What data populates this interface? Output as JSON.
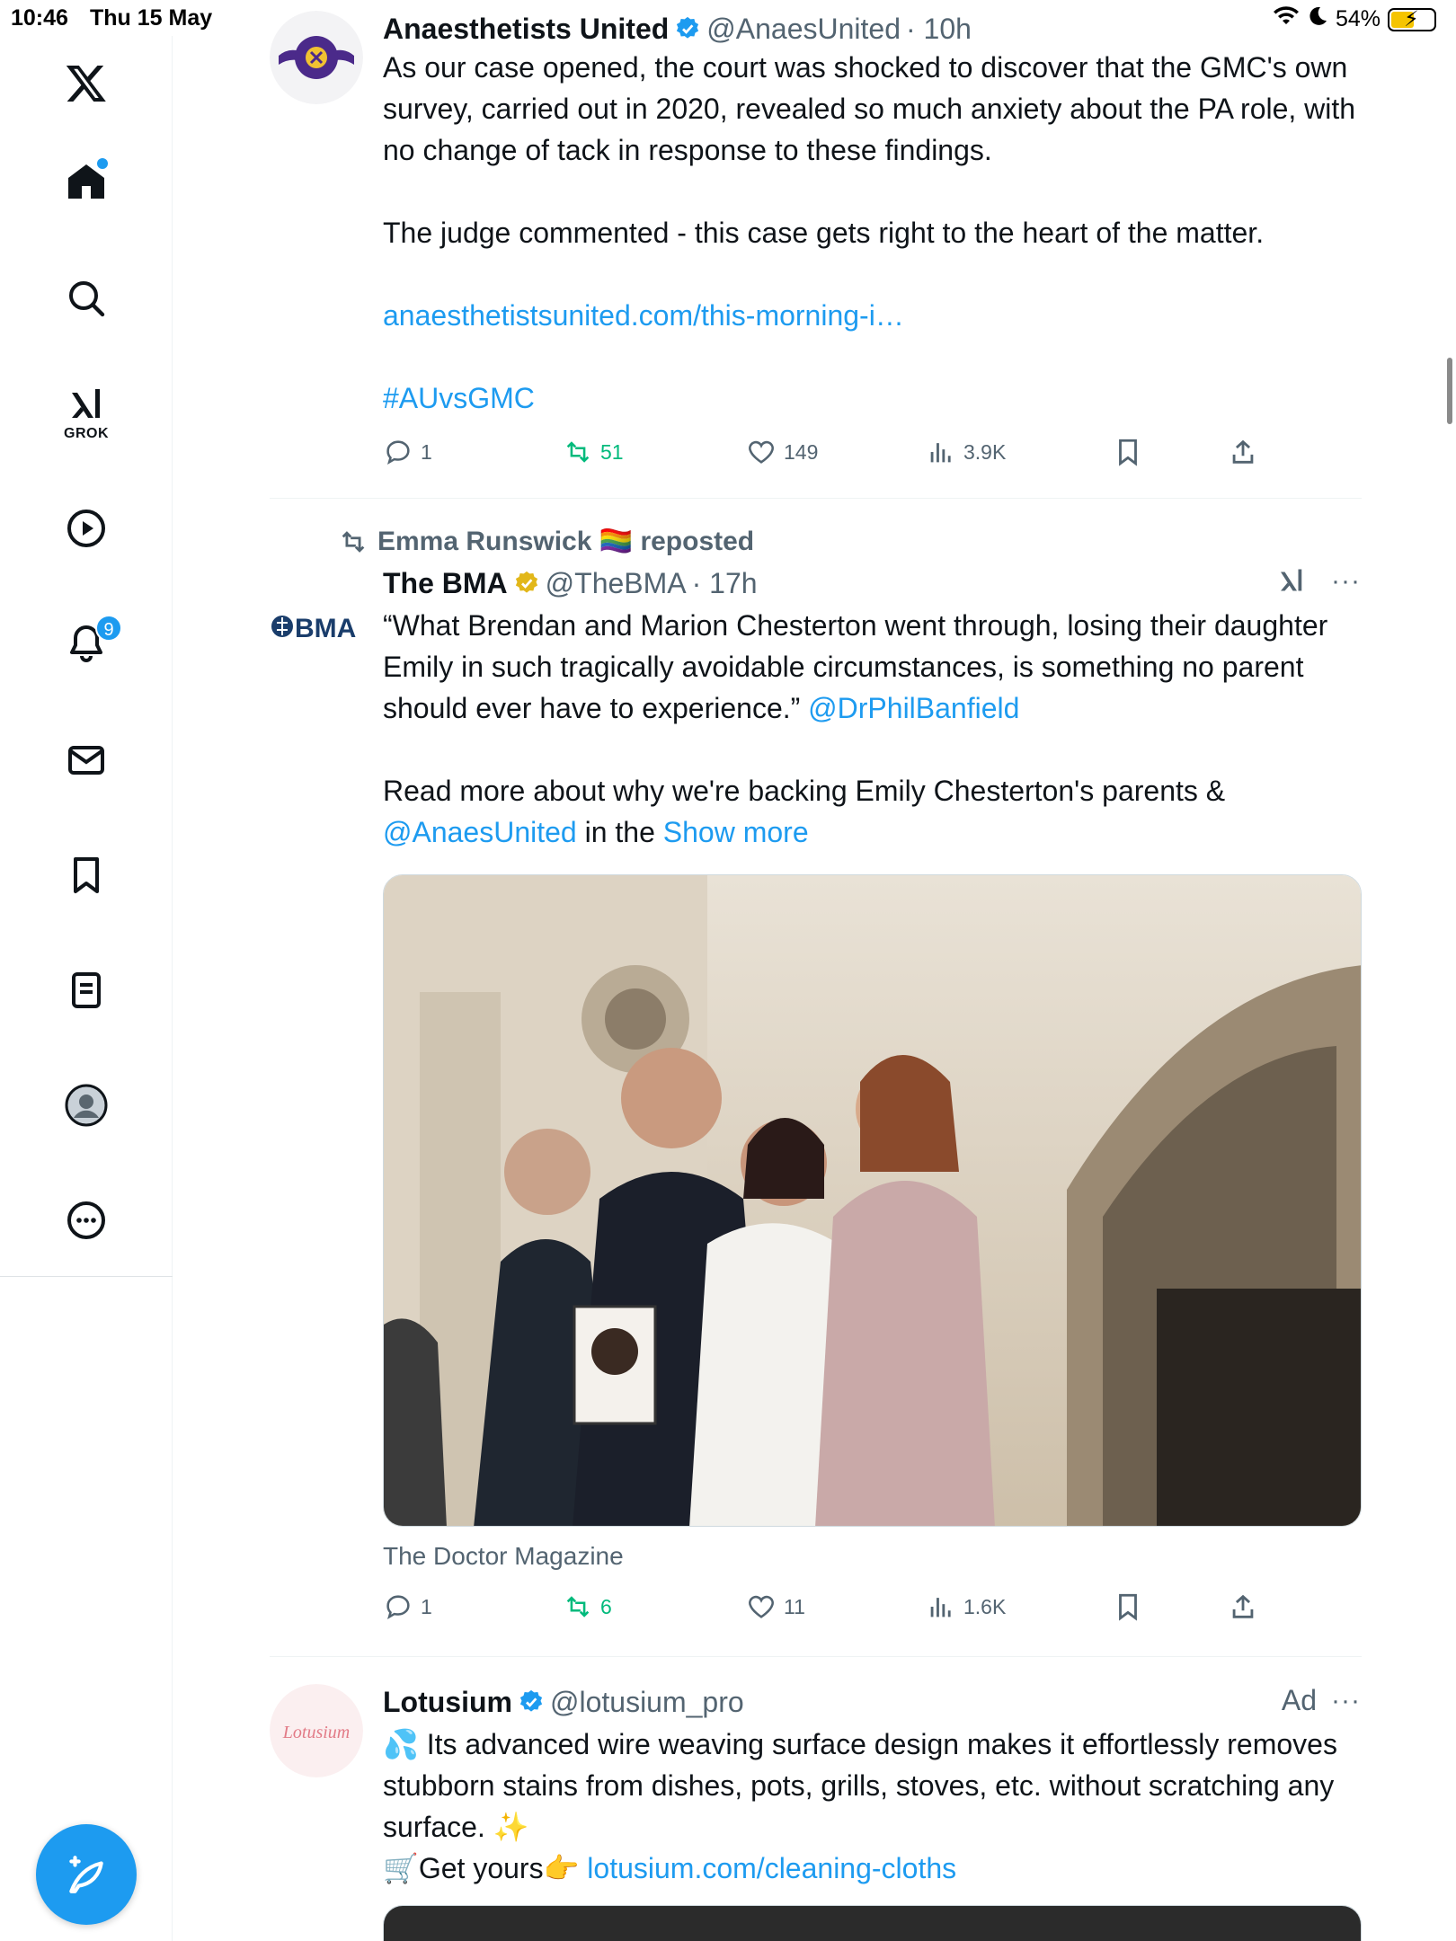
{
  "status_bar": {
    "time": "10:46",
    "date": "Thu 15 May",
    "battery": "54%",
    "battery_level": 0.54
  },
  "sidebar": {
    "grok_label": "GROK",
    "notifications_badge": "9"
  },
  "tweets": [
    {
      "name": "Anaesthetists United",
      "handle": "@AnaesUnited",
      "time": "· 10h",
      "text_1": "As our case opened, the court was shocked to discover that the GMC's own survey, carried out in 2020, revealed so much anxiety about the PA role, with no change of tack in response to these findings.",
      "text_2": "The judge commented - this case gets right to the heart of the matter.",
      "link": "anaesthetistsunited.com/this-morning-i…",
      "hashtag": "#AUvsGMC",
      "replies": "1",
      "reposts": "51",
      "likes": "149",
      "views": "3.9K"
    },
    {
      "repost_by": "Emma Runswick 🏳️‍🌈 reposted",
      "avatar_text": "BMA",
      "name": "The BMA",
      "handle": "@TheBMA",
      "time": "· 17h",
      "text_1a": "“What Brendan and Marion Chesterton went through, losing their daughter Emily in such tragically avoidable circumstances, is something no parent should ever have to experience.” ",
      "mention_1": "@DrPhilBanfield",
      "text_2a": "Read more about why we're backing Emily Chesterton's parents & ",
      "mention_2": "@AnaesUnited",
      "text_2b": " in the ",
      "show_more": "Show more",
      "media_source": "The Doctor Magazine",
      "replies": "1",
      "reposts": "6",
      "likes": "11",
      "views": "1.6K"
    },
    {
      "avatar_text": "Lotusium",
      "name": "Lotusium",
      "handle": "@lotusium_pro",
      "ad_label": "Ad",
      "text_1": "💦 Its advanced wire weaving surface design makes it effortlessly removes stubborn stains from dishes, pots, grills, stoves, etc. without scratching any surface. ✨",
      "text_2a": "🛒Get yours👉 ",
      "link": "lotusium.com/cleaning-cloths"
    }
  ],
  "colors": {
    "accent": "#1d9bf0",
    "repost_green": "#00ba7c",
    "muted": "#536471",
    "verified_gold": "#e2b719"
  }
}
